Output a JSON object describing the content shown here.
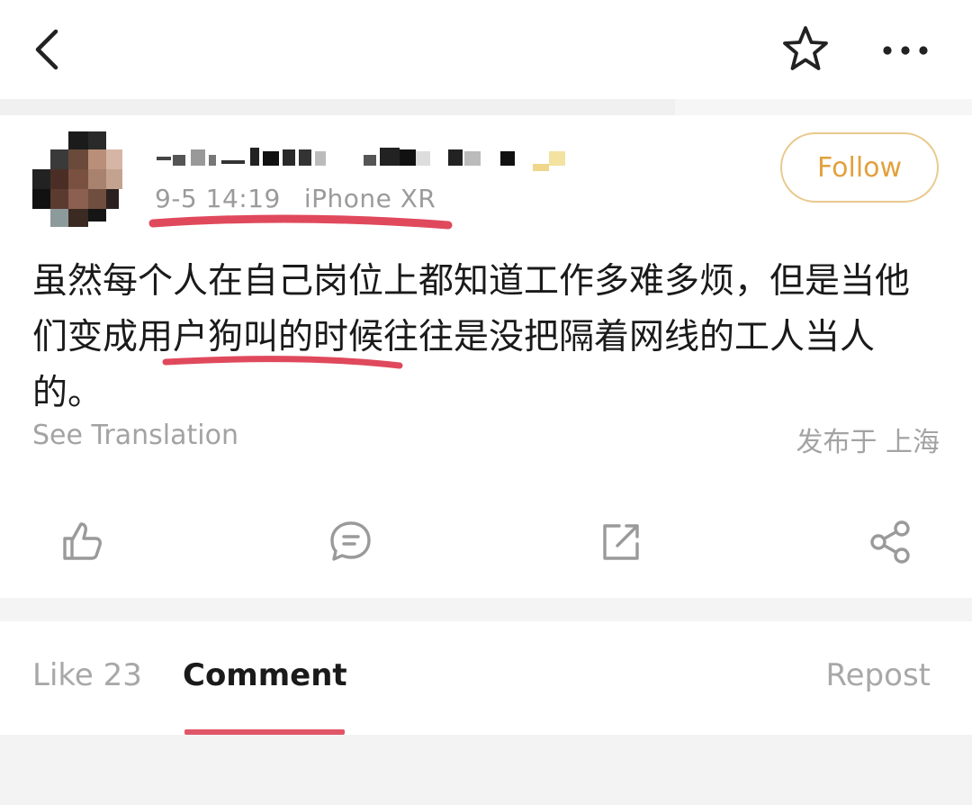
{
  "meta": {
    "timestamp": "9-5 14:19",
    "device": "iPhone XR"
  },
  "follow": {
    "label": "Follow"
  },
  "post": {
    "text": "虽然每个人在自己岗位上都知道工作多难多烦，但是当他们变成用户狗叫的时候往往是没把隔着网线的工人当人的。",
    "see_translation": "See Translation",
    "location": "发布于 上海"
  },
  "actions": [
    "like-icon",
    "comment-icon",
    "edit-icon",
    "share-icon"
  ],
  "tabs": {
    "like": "Like 23",
    "comment": "Comment",
    "repost": "Repost"
  },
  "colors": {
    "accent_follow": "#e1a13d",
    "tab_indicator": "#e05568",
    "annotation_red": "#e0495c"
  }
}
